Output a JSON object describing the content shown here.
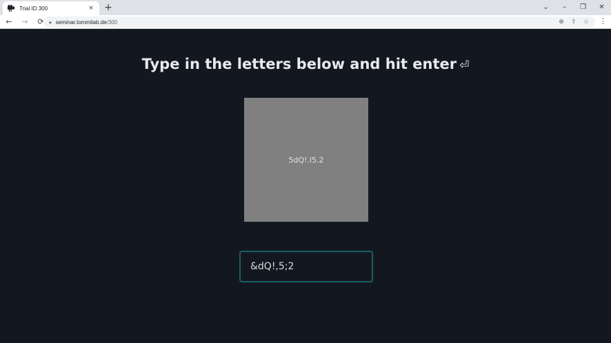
{
  "browser": {
    "tab_title": "Trial ID 300",
    "tab_icon": "projector-icon",
    "new_tab_label": "+",
    "close_tab_label": "×",
    "url_host": "seminar.tommilab.de",
    "url_path": "/300",
    "window_controls": [
      "⌄",
      "–",
      "❐",
      "✕"
    ]
  },
  "page": {
    "heading": "Type in the letters below and hit enter",
    "enter_icon": "⏎",
    "captcha_text": "5dQ!.l5.2",
    "captcha_background": "#808080",
    "answer_value": "&dQ!,5;2",
    "background": "#131820",
    "input_border_color": "#1b5f6a"
  }
}
